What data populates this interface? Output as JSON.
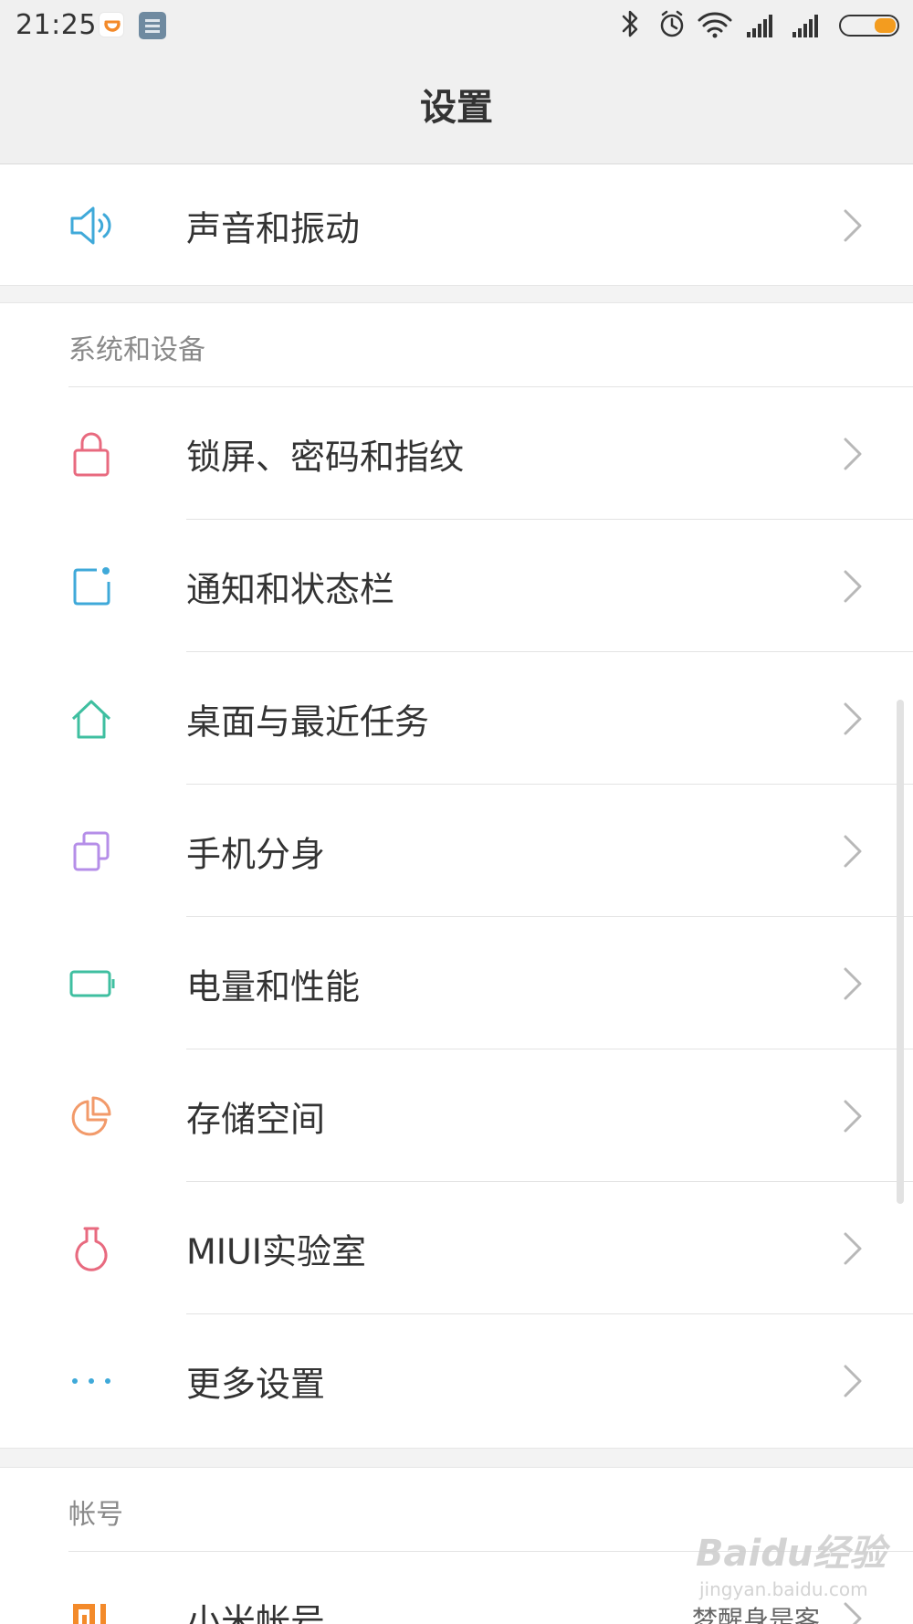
{
  "status_bar": {
    "time": "21:25",
    "icons": [
      "didi-app-icon",
      "note-app-icon",
      "bluetooth-icon",
      "alarm-icon",
      "wifi-icon",
      "signal-icon",
      "signal-icon",
      "battery-icon"
    ]
  },
  "header": {
    "title": "设置"
  },
  "top_item": {
    "label": "声音和振动",
    "icon": "speaker-icon",
    "color": "#3fa9d9"
  },
  "sections": [
    {
      "title": "系统和设备",
      "items": [
        {
          "label": "锁屏、密码和指纹",
          "icon": "lock-icon",
          "color": "#e86a7f"
        },
        {
          "label": "通知和状态栏",
          "icon": "notification-icon",
          "color": "#3fa9d9"
        },
        {
          "label": "桌面与最近任务",
          "icon": "home-icon",
          "color": "#3fbfa0"
        },
        {
          "label": "手机分身",
          "icon": "second-space-icon",
          "color": "#b58ee8"
        },
        {
          "label": "电量和性能",
          "icon": "battery-outline-icon",
          "color": "#3fbfa0"
        },
        {
          "label": "存储空间",
          "icon": "storage-pie-icon",
          "color": "#f29a6a"
        },
        {
          "label": "MIUI实验室",
          "icon": "lab-flask-icon",
          "color": "#e86a7f"
        },
        {
          "label": "更多设置",
          "icon": "more-dots-icon",
          "color": "#3fa9d9"
        }
      ]
    },
    {
      "title": "帐号",
      "items": [
        {
          "label": "小米帐号",
          "value": "梦醒身是客",
          "icon": "mi-logo-icon",
          "color": "#f38a2a"
        }
      ]
    }
  ],
  "watermark": {
    "logo": "Baidu经验",
    "sub": "jingyan.baidu.com"
  },
  "colors": {
    "bar_bg": "#f0f0f0",
    "text": "#333333",
    "section_text": "#8a8a8a",
    "chevron": "#b8b8b8",
    "battery": "#f39c1f"
  }
}
